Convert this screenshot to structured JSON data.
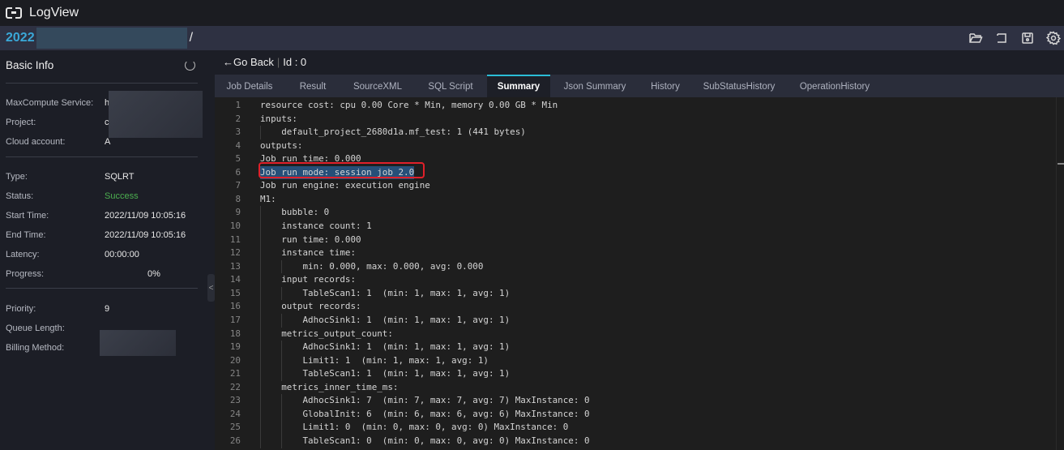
{
  "app": {
    "title": "LogView",
    "logo_icon": "logview-bracket-icon"
  },
  "path": {
    "prefix": "2022",
    "suffix": "/"
  },
  "toolbar": {
    "icons": [
      "folder-open-icon",
      "return-icon",
      "save-icon",
      "gear-icon"
    ]
  },
  "sidebar": {
    "title": "Basic Info",
    "group1": [
      {
        "label": "MaxCompute Service:",
        "value": "h"
      },
      {
        "label": "Project:",
        "value": "c"
      },
      {
        "label": "Cloud account:",
        "value": "A"
      }
    ],
    "group2": [
      {
        "label": "Type:",
        "value": "SQLRT"
      },
      {
        "label": "Status:",
        "value": "Success"
      },
      {
        "label": "Start Time:",
        "value": "2022/11/09 10:05:16"
      },
      {
        "label": "End Time:",
        "value": "2022/11/09 10:05:16"
      },
      {
        "label": "Latency:",
        "value": "00:00:00"
      },
      {
        "label": "Progress:",
        "value": "0%"
      }
    ],
    "group3": [
      {
        "label": "Priority:",
        "value": "9"
      },
      {
        "label": "Queue Length:",
        "value": ""
      },
      {
        "label": "Billing Method:",
        "value": ""
      }
    ],
    "status_color": "#4caf50"
  },
  "main": {
    "go_back": "←Go Back",
    "id_label": "Id : 0",
    "tabs": [
      "Job Details",
      "Result",
      "SourceXML",
      "SQL Script",
      "Summary",
      "Json Summary",
      "History",
      "SubStatusHistory",
      "OperationHistory"
    ],
    "active_tab": "Summary",
    "accent": "#2bbcd6",
    "code_lines": [
      "resource cost: cpu 0.00 Core * Min, memory 0.00 GB * Min",
      "inputs:",
      "    default_project_2680d1a.mf_test: 1 (441 bytes)",
      "outputs:",
      "Job run time: 0.000",
      "Job run mode: session job 2.0",
      "Job run engine: execution engine",
      "M1:",
      "    bubble: 0",
      "    instance count: 1",
      "    run time: 0.000",
      "    instance time:",
      "        min: 0.000, max: 0.000, avg: 0.000",
      "    input records:",
      "        TableScan1: 1  (min: 1, max: 1, avg: 1)",
      "    output records:",
      "        AdhocSink1: 1  (min: 1, max: 1, avg: 1)",
      "    metrics_output_count:",
      "        AdhocSink1: 1  (min: 1, max: 1, avg: 1)",
      "        Limit1: 1  (min: 1, max: 1, avg: 1)",
      "        TableScan1: 1  (min: 1, max: 1, avg: 1)",
      "    metrics_inner_time_ms:",
      "        AdhocSink1: 7  (min: 7, max: 7, avg: 7) MaxInstance: 0",
      "        GlobalInit: 6  (min: 6, max: 6, avg: 6) MaxInstance: 0",
      "        Limit1: 0  (min: 0, max: 0, avg: 0) MaxInstance: 0",
      "        TableScan1: 0  (min: 0, max: 0, avg: 0) MaxInstance: 0"
    ],
    "selected_line": 6
  }
}
